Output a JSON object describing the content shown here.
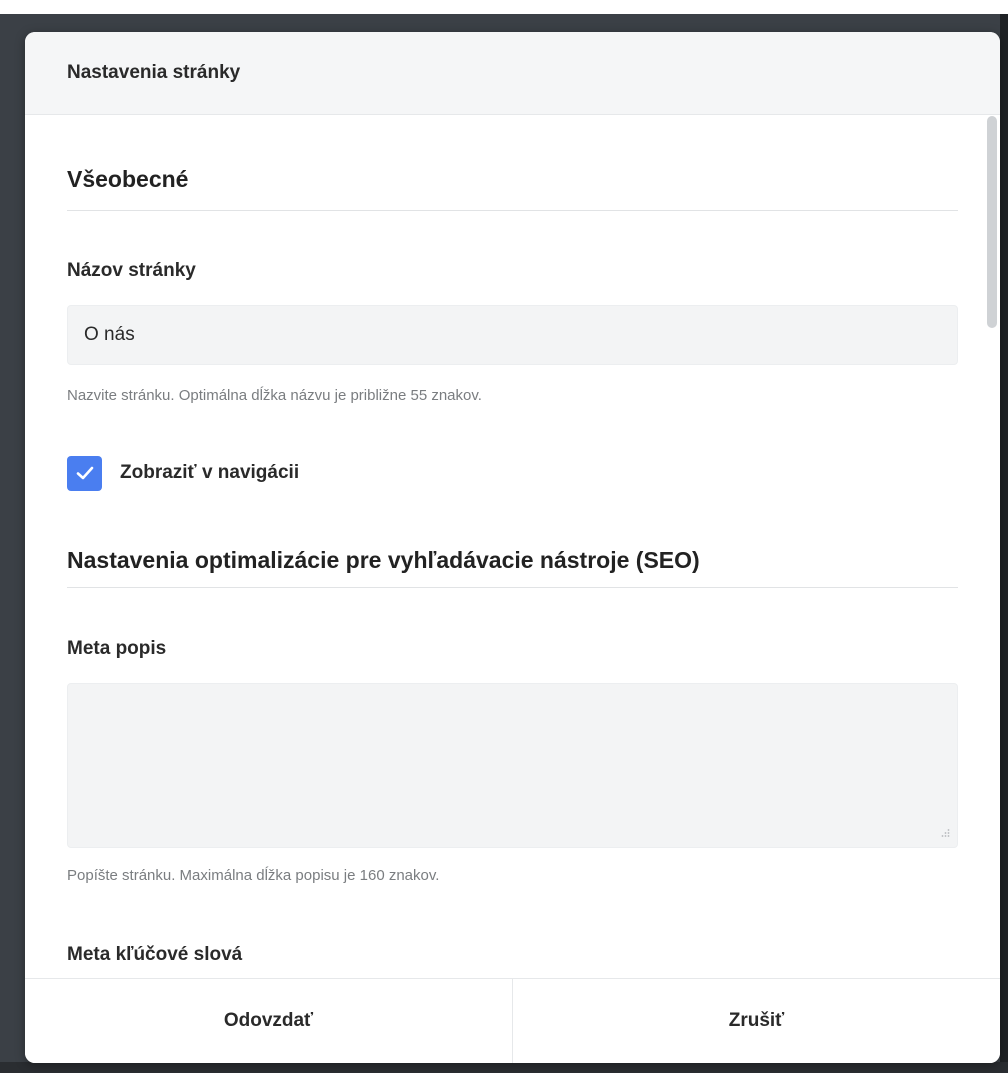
{
  "dialog": {
    "title": "Nastavenia stránky"
  },
  "general": {
    "heading": "Všeobecné",
    "page_name": {
      "label": "Názov stránky",
      "value": "O nás",
      "help": "Nazvite stránku. Optimálna dĺžka názvu je približne 55 znakov."
    },
    "show_in_nav": {
      "label": "Zobraziť v navigácii",
      "checked": true
    }
  },
  "seo": {
    "heading": "Nastavenia optimalizácie pre vyhľadávacie nástroje (SEO)",
    "meta_description": {
      "label": "Meta popis",
      "value": "",
      "help": "Popíšte stránku. Maximálna dĺžka popisu je 160 znakov."
    },
    "meta_keywords": {
      "label": "Meta kľúčové slová"
    }
  },
  "footer": {
    "submit_label": "Odovzdať",
    "cancel_label": "Zrušiť"
  },
  "colors": {
    "checkbox_accent": "#4a7ef0",
    "header_bg": "#f5f6f7",
    "input_bg": "#f3f4f5"
  },
  "icons": {
    "checkbox_mark": "check-icon",
    "textarea_grip": "resize-grip-icon"
  }
}
